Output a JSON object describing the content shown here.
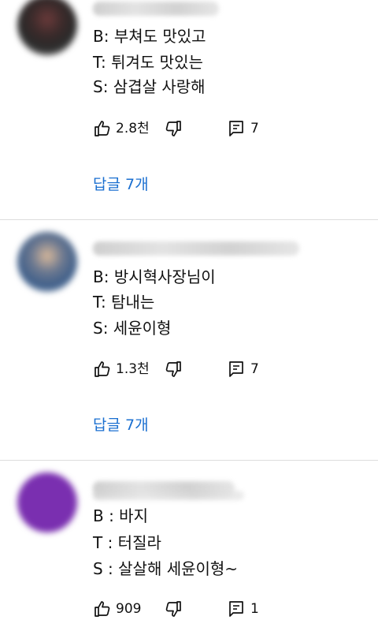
{
  "comments": [
    {
      "lines": [
        "B: 부쳐도 맛있고",
        "T: 튀겨도 맛있는",
        "S: 삼겹살 사랑해"
      ],
      "likes": "2.8천",
      "reply_count": "7",
      "replies_label": "답글 7개"
    },
    {
      "lines": [
        "B: 방시혁사장님이",
        "T: 탐내는",
        "S: 세윤이형"
      ],
      "likes": "1.3천",
      "reply_count": "7",
      "replies_label": "답글 7개"
    },
    {
      "lines": [
        "B : 바지",
        "T : 터질라",
        "S : 살살해 세윤이형~"
      ],
      "likes": "909",
      "reply_count": "1"
    }
  ],
  "icons": {
    "like": "thumbs-up-icon",
    "dislike": "thumbs-down-icon",
    "reply": "comment-icon"
  },
  "colors": {
    "link": "#1a6fd0",
    "text": "#111111",
    "divider": "#dddddd"
  }
}
